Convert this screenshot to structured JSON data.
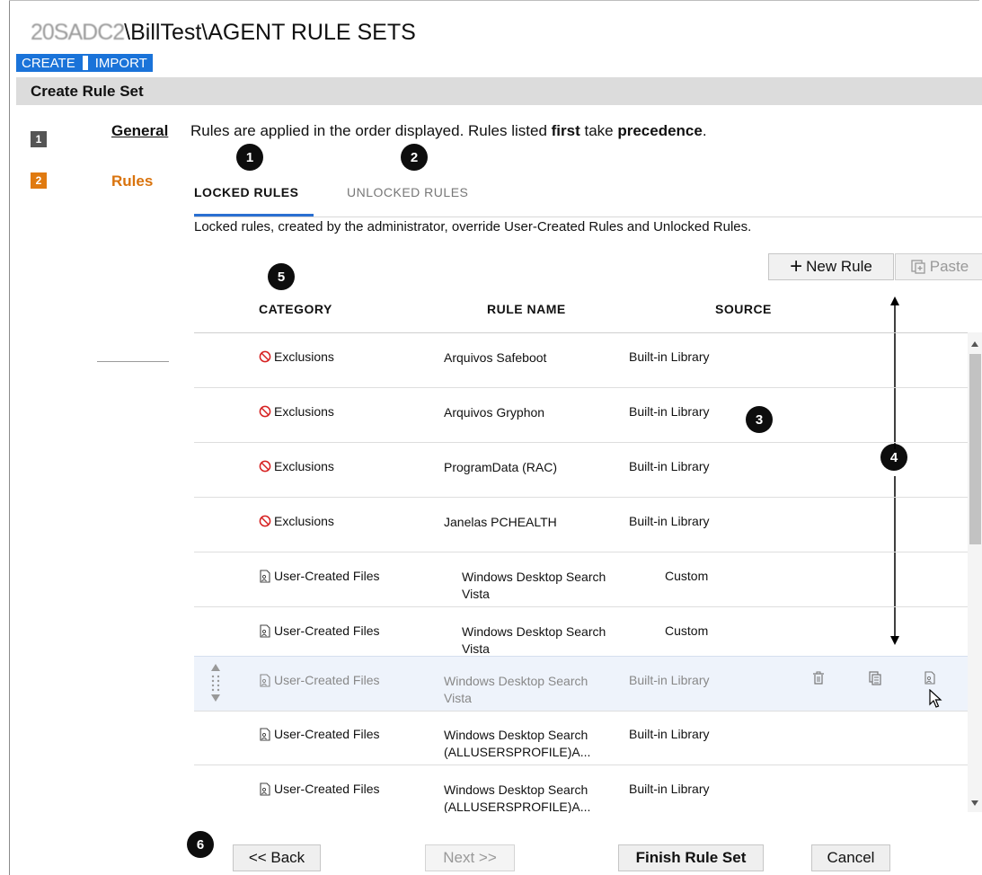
{
  "header": {
    "title_prefix": "20SADC2",
    "title_path": "\\BillTest\\AGENT RULE SETS"
  },
  "topnav": {
    "create": "CREATE",
    "import": "IMPORT"
  },
  "section": {
    "title": "Create Rule Set"
  },
  "steps": [
    {
      "num": "1",
      "label": "General"
    },
    {
      "num": "2",
      "label": "Rules"
    }
  ],
  "intro": {
    "a": "Rules are applied in the order displayed. Rules listed ",
    "b": "first",
    "c": " take ",
    "d": "precedence",
    "e": "."
  },
  "tabs": {
    "locked": "LOCKED RULES",
    "unlocked": "UNLOCKED RULES"
  },
  "description": "Locked rules, created by the administrator, override User-Created Rules and Unlocked Rules.",
  "toolbar": {
    "new_rule": "New Rule",
    "paste": "Paste"
  },
  "table": {
    "headers": {
      "category": "CATEGORY",
      "rule_name": "RULE NAME",
      "source": "SOURCE"
    },
    "rows": [
      {
        "category": "Exclusions",
        "name": "Arquivos Safeboot",
        "source": "Built-in Library"
      },
      {
        "category": "Exclusions",
        "name": "Arquivos Gryphon",
        "source": "Built-in Library"
      },
      {
        "category": "Exclusions",
        "name": "ProgramData (RAC)",
        "source": "Built-in Library"
      },
      {
        "category": "Exclusions",
        "name": "Janelas PCHEALTH",
        "source": "Built-in Library"
      },
      {
        "category": "User-Created Files",
        "name": "Windows Desktop Search Vista",
        "source": "Custom"
      },
      {
        "category": "User-Created Files",
        "name": "Windows Desktop Search Vista",
        "source": "Custom"
      },
      {
        "category": "User-Created Files",
        "name": "Windows Desktop Search Vista",
        "source": "Built-in Library"
      },
      {
        "category": "User-Created Files",
        "name": "Windows Desktop Search (ALLUSERSPROFILE)A...",
        "source": "Built-in Library"
      },
      {
        "category": "User-Created Files",
        "name": "Windows Desktop Search (ALLUSERSPROFILE)A...",
        "source": "Built-in Library"
      }
    ]
  },
  "callouts": [
    "1",
    "2",
    "3",
    "4",
    "5",
    "6"
  ],
  "footer": {
    "back": "<< Back",
    "next": "Next >>",
    "finish": "Finish Rule Set",
    "cancel": "Cancel"
  },
  "colors": {
    "accent": "#1a73d9",
    "step_active": "#e07a10",
    "exclusion_icon": "#d62020"
  }
}
